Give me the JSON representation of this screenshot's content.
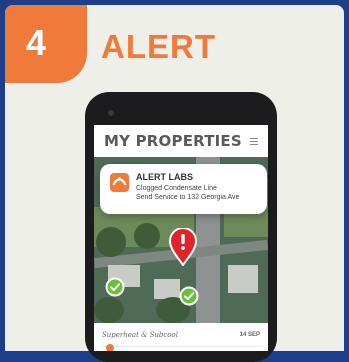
{
  "step": {
    "number": "4",
    "title": "ALERT"
  },
  "app": {
    "title": "MY PROPERTIES"
  },
  "notification": {
    "app_name": "ALERT LABS",
    "line1": "Clogged Condensate Line",
    "line2": "Send Service to 132 Georgia Ave"
  },
  "footer": {
    "title": "Superheat & Subcool",
    "date": "14 SEP"
  },
  "colors": {
    "accent": "#f07a3a",
    "alert": "#e0242b",
    "ok": "#6cbf3c",
    "frame": "#1d3e8c"
  },
  "icons": {
    "menu": "menu-icon",
    "brand": "alert-labs-logo-icon",
    "alert": "alert-pin-icon",
    "ok": "check-pin-icon"
  }
}
